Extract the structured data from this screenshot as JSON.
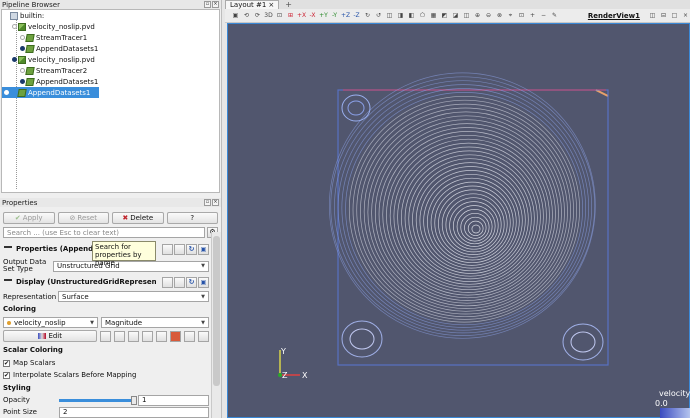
{
  "pipeline": {
    "title": "Pipeline Browser",
    "items": [
      {
        "label": "builtin:",
        "visible": null,
        "icon": "server-icon"
      },
      {
        "label": "velocity_noslip.pvd",
        "visible": false,
        "icon": "reader-icon"
      },
      {
        "label": "StreamTracer1",
        "visible": false,
        "icon": "filter-icon"
      },
      {
        "label": "AppendDatasets1",
        "visible": true,
        "icon": "filter-icon"
      },
      {
        "label": "velocity_noslip.pvd",
        "visible": true,
        "icon": "reader-icon"
      },
      {
        "label": "StreamTracer2",
        "visible": false,
        "icon": "filter-icon"
      },
      {
        "label": "AppendDatasets1",
        "visible": true,
        "icon": "filter-icon"
      },
      {
        "label": "AppendDatasets1",
        "visible": true,
        "icon": "filter-icon",
        "selected": true
      }
    ]
  },
  "properties": {
    "title": "Properties",
    "apply_label": "Apply",
    "reset_label": "Reset",
    "delete_label": "Delete",
    "help_label": "?",
    "search_placeholder": "Search ... (use Esc to clear text)",
    "tooltip": "Search for properties by name",
    "section_properties": "Properties (AppendDa",
    "output_type_label": "Output Data Set Type",
    "output_type_value": "Unstructured Grid",
    "section_display": "Display (UnstructuredGridRepresenta",
    "representation_label": "Representation",
    "representation_value": "Surface",
    "coloring_label": "Coloring",
    "color_array": "velocity_noslip",
    "color_component": "Magnitude",
    "edit_label": "Edit",
    "scalar_coloring_label": "Scalar Coloring",
    "map_scalars_label": "Map Scalars",
    "interpolate_label": "Interpolate Scalars Before Mapping",
    "styling_label": "Styling",
    "opacity_label": "Opacity",
    "opacity_value": "1",
    "point_size_label": "Point Size",
    "point_size_value": "2"
  },
  "layout": {
    "tab_label": "Layout #1",
    "tab_close": "×",
    "tab_add": "+",
    "view_label": "RenderView1",
    "toolbar_3d": "3D"
  },
  "view": {
    "legend_title": "velocity",
    "legend_min": "0.0",
    "axis_y": "Y",
    "axis_x": "X",
    "axis_z": "Z",
    "colors": {
      "background": "#51566e",
      "streamline": "#e8e8ec",
      "low": "#3b4cc0",
      "high": "#b40426"
    }
  }
}
